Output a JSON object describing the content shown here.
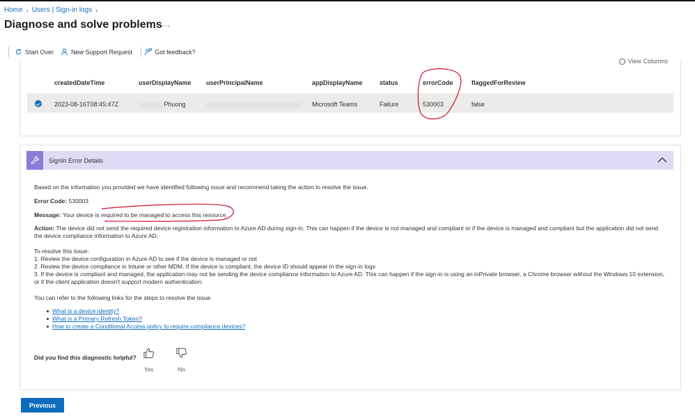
{
  "breadcrumb": {
    "home": "Home",
    "users": "Users | Sign-in logs"
  },
  "page": {
    "title": "Diagnose and solve problems",
    "more": "..."
  },
  "toolbar": {
    "start_over": "Start Over",
    "new_support_request": "New Support Request",
    "got_feedback": "Got feedback?"
  },
  "grid": {
    "view_columns": "View Columns",
    "columns": [
      "createdDateTime",
      "userDisplayName",
      "userPrincipalName",
      "appDisplayName",
      "status",
      "errorCode",
      "flaggedForReview"
    ],
    "row": {
      "createdDateTime": "2023-08-16T08:45:47Z",
      "userDisplayName": "Phuong",
      "appDisplayName": "Microsoft Teams",
      "status": "Failure",
      "errorCode": "530003",
      "flaggedForReview": "false"
    }
  },
  "details": {
    "header": "SignIn Error Details",
    "intro": "Based on the information you provided we have identified following issue and recommend taking the action to resolve the issue.",
    "error_code_label": "Error Code:",
    "error_code_value": "530003",
    "message_label": "Message:",
    "message_value": "Your device is required to be managed to access this resource.",
    "action_label": "Action:",
    "action_value": "The device did not send the required device registration information to Azure AD during sign-in. This can happen if the device is not managed and compliant or if the device is managed and compliant but the application did not send the device compliance information to Azure AD.",
    "resolve_heading": "To resolve this issue:",
    "steps": [
      "1. Review the device configuration in Azure AD to see if the device is managed or not",
      "2. Review the device compliance in Intune or other MDM. If the device is compliant, the device ID should appear in the sign-in logs",
      "3. If the device is compliant and managed, the application may not be sending the device compliance information to Azure AD. This can happen if the sign-in is using an inPrivate browser, a Chrome browser without the Windows 10 extension, or if the client application doesn't support modern authentication."
    ],
    "links_intro": "You can refer to the following links for the steps to resolve the issue.",
    "links": [
      "What is a device identity?",
      "What is a Primary Refresh Token?",
      "How to create a Conditional Access policy to require compliance devices?"
    ],
    "feedback_question": "Did you find this diagnostic helpful?",
    "yes": "Yes",
    "no": "No"
  },
  "footer": {
    "previous": "Previous"
  },
  "colors": {
    "accent": "#0f6cbd",
    "header_bg": "#e0dbf5",
    "wrench_bg": "#8b7dd6",
    "annotation": "#d0102a"
  }
}
